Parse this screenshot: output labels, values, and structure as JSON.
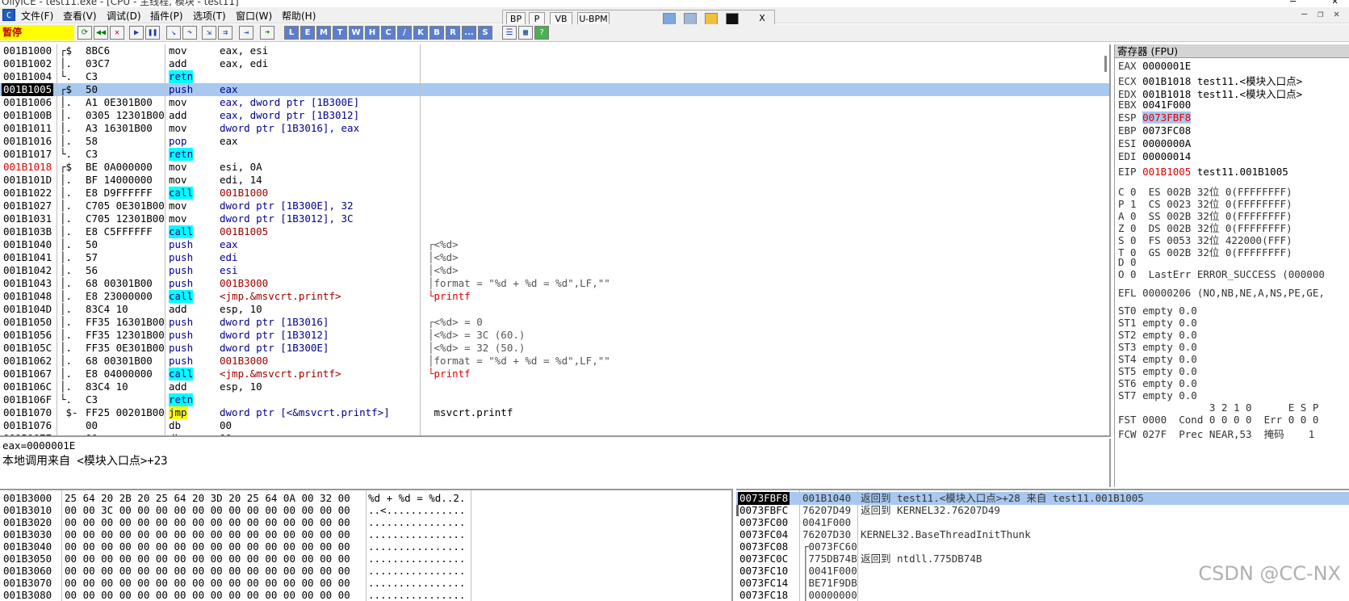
{
  "window": {
    "title": "OllyICE - test11.exe - [CPU - 主线程, 模块 - test11]"
  },
  "menu": [
    "文件(F)",
    "查看(V)",
    "调试(D)",
    "插件(P)",
    "选项(T)",
    "窗口(W)",
    "帮助(H)"
  ],
  "floatbar": {
    "buttons": [
      "BP",
      "P",
      "VB",
      "U-BPM"
    ],
    "close": "X"
  },
  "status": "暂停",
  "toolbar_letters": [
    "L",
    "E",
    "M",
    "T",
    "W",
    "H",
    "C",
    "/",
    "K",
    "B",
    "R",
    "...",
    "S"
  ],
  "disasm": [
    {
      "addr": "001B1000",
      "brk": "┌$",
      "hex": "8BC6",
      "mn": "mov",
      "op": "eax, esi"
    },
    {
      "addr": "001B1002",
      "brk": "│.",
      "hex": "03C7",
      "mn": "add",
      "op": "eax, edi"
    },
    {
      "addr": "001B1004",
      "brk": "└.",
      "hex": "C3",
      "mn": "retn",
      "op": ""
    },
    {
      "addr": "001B1005",
      "brk": "┌$",
      "hex": "50",
      "mn": "push",
      "op": "eax"
    },
    {
      "addr": "001B1006",
      "brk": "│.",
      "hex": "A1 0E301B00",
      "mn": "mov",
      "op": "eax, dword ptr [1B300E]"
    },
    {
      "addr": "001B100B",
      "brk": "│.",
      "hex": "0305 12301B00",
      "mn": "add",
      "op": "eax, dword ptr [1B3012]"
    },
    {
      "addr": "001B1011",
      "brk": "│.",
      "hex": "A3 16301B00",
      "mn": "mov",
      "op": "dword ptr [1B3016], eax"
    },
    {
      "addr": "001B1016",
      "brk": "│.",
      "hex": "58",
      "mn": "pop",
      "op": "eax"
    },
    {
      "addr": "001B1017",
      "brk": "└.",
      "hex": "C3",
      "mn": "retn",
      "op": ""
    },
    {
      "addr": "001B1018",
      "brk": "┌$",
      "hex": "BE 0A000000",
      "mn": "mov",
      "op": "esi, 0A"
    },
    {
      "addr": "001B101D",
      "brk": "│.",
      "hex": "BF 14000000",
      "mn": "mov",
      "op": "edi, 14"
    },
    {
      "addr": "001B1022",
      "brk": "│.",
      "hex": "E8 D9FFFFFF",
      "mn": "call",
      "op": "001B1000"
    },
    {
      "addr": "001B1027",
      "brk": "│.",
      "hex": "C705 0E301B00",
      "mn": "mov",
      "op": "dword ptr [1B300E], 32"
    },
    {
      "addr": "001B1031",
      "brk": "│.",
      "hex": "C705 12301B00",
      "mn": "mov",
      "op": "dword ptr [1B3012], 3C"
    },
    {
      "addr": "001B103B",
      "brk": "│.",
      "hex": "E8 C5FFFFFF",
      "mn": "call",
      "op": "001B1005"
    },
    {
      "addr": "001B1040",
      "brk": "│.",
      "hex": "50",
      "mn": "push",
      "op": "eax",
      "com": "┌<%d>"
    },
    {
      "addr": "001B1041",
      "brk": "│.",
      "hex": "57",
      "mn": "push",
      "op": "edi",
      "com": "│<%d>"
    },
    {
      "addr": "001B1042",
      "brk": "│.",
      "hex": "56",
      "mn": "push",
      "op": "esi",
      "com": "│<%d>"
    },
    {
      "addr": "001B1043",
      "brk": "│.",
      "hex": "68 00301B00",
      "mn": "push",
      "op": "001B3000",
      "com": "│format = \"%d + %d = %d\",LF,\"\""
    },
    {
      "addr": "001B1048",
      "brk": "│.",
      "hex": "E8 23000000",
      "mn": "call",
      "op": "<jmp.&msvcrt.printf>",
      "com": "└printf"
    },
    {
      "addr": "001B104D",
      "brk": "│.",
      "hex": "83C4 10",
      "mn": "add",
      "op": "esp, 10"
    },
    {
      "addr": "001B1050",
      "brk": "│.",
      "hex": "FF35 16301B00",
      "mn": "push",
      "op": "dword ptr [1B3016]",
      "com": "┌<%d> = 0"
    },
    {
      "addr": "001B1056",
      "brk": "│.",
      "hex": "FF35 12301B00",
      "mn": "push",
      "op": "dword ptr [1B3012]",
      "com": "│<%d> = 3C (60.)"
    },
    {
      "addr": "001B105C",
      "brk": "│.",
      "hex": "FF35 0E301B00",
      "mn": "push",
      "op": "dword ptr [1B300E]",
      "com": "│<%d> = 32 (50.)"
    },
    {
      "addr": "001B1062",
      "brk": "│.",
      "hex": "68 00301B00",
      "mn": "push",
      "op": "001B3000",
      "com": "│format = \"%d + %d = %d\",LF,\"\""
    },
    {
      "addr": "001B1067",
      "brk": "│.",
      "hex": "E8 04000000",
      "mn": "call",
      "op": "<jmp.&msvcrt.printf>",
      "com": "└printf"
    },
    {
      "addr": "001B106C",
      "brk": "│.",
      "hex": "83C4 10",
      "mn": "add",
      "op": "esp, 10"
    },
    {
      "addr": "001B106F",
      "brk": "└.",
      "hex": "C3",
      "mn": "retn",
      "op": ""
    },
    {
      "addr": "001B1070",
      "brk": " $-",
      "hex": "FF25 00201B00",
      "mn": "jmp",
      "op": "dword ptr [<&msvcrt.printf>]",
      "com": " msvcrt.printf"
    },
    {
      "addr": "001B1076",
      "brk": "",
      "hex": "00",
      "mn": "db",
      "op": "00"
    },
    {
      "addr": "001B1077",
      "brk": "",
      "hex": "00",
      "mn": "db",
      "op": "00"
    }
  ],
  "info": {
    "line1": "eax=0000001E",
    "line2": "本地调用来自 <模块入口点>+23"
  },
  "registers": {
    "header": "寄存器 (FPU)",
    "gp": [
      {
        "name": "EAX",
        "val": "0000001E",
        "extra": ""
      },
      {
        "name": "ECX",
        "val": "001B1018",
        "extra": "test11.<模块入口点>"
      },
      {
        "name": "EDX",
        "val": "001B1018",
        "extra": "test11.<模块入口点>"
      },
      {
        "name": "EBX",
        "val": "0041F000",
        "extra": ""
      },
      {
        "name": "ESP",
        "val": "0073FBF8",
        "extra": ""
      },
      {
        "name": "EBP",
        "val": "0073FC08",
        "extra": ""
      },
      {
        "name": "ESI",
        "val": "0000000A",
        "extra": ""
      },
      {
        "name": "EDI",
        "val": "00000014",
        "extra": ""
      }
    ],
    "eip": {
      "name": "EIP",
      "val": "001B1005",
      "extra": "test11.001B1005"
    },
    "flags": [
      "C 0  ES 002B 32位 0(FFFFFFFF)",
      "P 1  CS 0023 32位 0(FFFFFFFF)",
      "A 0  SS 002B 32位 0(FFFFFFFF)",
      "Z 0  DS 002B 32位 0(FFFFFFFF)",
      "S 0  FS 0053 32位 422000(FFF)",
      "T 0  GS 002B 32位 0(FFFFFFFF)",
      "D 0",
      "O 0  LastErr ERROR_SUCCESS (000000"
    ],
    "efl": "EFL 00000206 (NO,NB,NE,A,NS,PE,GE,",
    "st": [
      "ST0 empty 0.0",
      "ST1 empty 0.0",
      "ST2 empty 0.0",
      "ST3 empty 0.0",
      "ST4 empty 0.0",
      "ST5 empty 0.0",
      "ST6 empty 0.0",
      "ST7 empty 0.0"
    ],
    "fpu_hdr": "               3 2 1 0      E S P",
    "fst": "FST 0000  Cond 0 0 0 0  Err 0 0 0",
    "fcw": "FCW 027F  Prec NEAR,53  掩码    1"
  },
  "dump": [
    {
      "addr": "001B3000",
      "hex": "25 64 20 2B 20 25 64 20 3D 20 25 64 0A 00 32 00",
      "ascii": "%d + %d = %d..2."
    },
    {
      "addr": "001B3010",
      "hex": "00 00 3C 00 00 00 00 00 00 00 00 00 00 00 00 00",
      "ascii": "..<............."
    },
    {
      "addr": "001B3020",
      "hex": "00 00 00 00 00 00 00 00 00 00 00 00 00 00 00 00",
      "ascii": "................"
    },
    {
      "addr": "001B3030",
      "hex": "00 00 00 00 00 00 00 00 00 00 00 00 00 00 00 00",
      "ascii": "................"
    },
    {
      "addr": "001B3040",
      "hex": "00 00 00 00 00 00 00 00 00 00 00 00 00 00 00 00",
      "ascii": "................"
    },
    {
      "addr": "001B3050",
      "hex": "00 00 00 00 00 00 00 00 00 00 00 00 00 00 00 00",
      "ascii": "................"
    },
    {
      "addr": "001B3060",
      "hex": "00 00 00 00 00 00 00 00 00 00 00 00 00 00 00 00",
      "ascii": "................"
    },
    {
      "addr": "001B3070",
      "hex": "00 00 00 00 00 00 00 00 00 00 00 00 00 00 00 00",
      "ascii": "................"
    },
    {
      "addr": "001B3080",
      "hex": "00 00 00 00 00 00 00 00 00 00 00 00 00 00 00 00",
      "ascii": "................"
    }
  ],
  "stack": [
    {
      "addr": "0073FBF8",
      "val": "001B1040",
      "com": "返回到 test11.<模块入口点>+28 来自 test11.001B1005"
    },
    {
      "addr": "0073FBFC",
      "val": "76207D49",
      "com": "返回到 KERNEL32.76207D49"
    },
    {
      "addr": "0073FC00",
      "val": "0041F000",
      "com": ""
    },
    {
      "addr": "0073FC04",
      "val": "76207D30",
      "com": "KERNEL32.BaseThreadInitThunk"
    },
    {
      "addr": "0073FC08",
      "val": "┌0073FC60",
      "com": ""
    },
    {
      "addr": "0073FC0C",
      "val": "│775DB74B",
      "com": "返回到 ntdll.775DB74B"
    },
    {
      "addr": "0073FC10",
      "val": "│0041F000",
      "com": ""
    },
    {
      "addr": "0073FC14",
      "val": "│BE71F9DB",
      "com": ""
    },
    {
      "addr": "0073FC18",
      "val": "│00000000",
      "com": ""
    }
  ],
  "watermark": "CSDN @CC-NX"
}
